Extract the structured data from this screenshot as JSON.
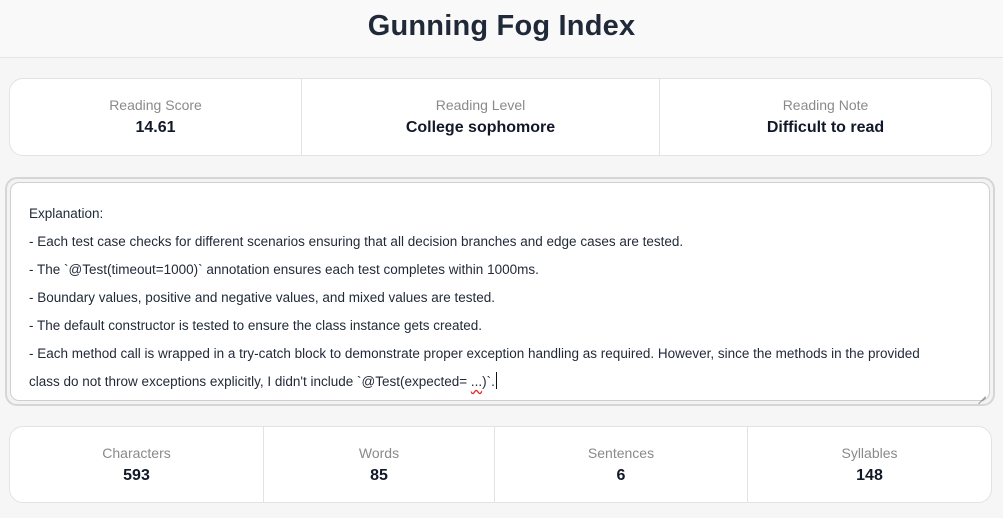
{
  "header": {
    "title": "Gunning Fog Index"
  },
  "reading": [
    {
      "label": "Reading Score",
      "value": "14.61"
    },
    {
      "label": "Reading Level",
      "value": "College sophomore"
    },
    {
      "label": "Reading Note",
      "value": "Difficult to read"
    }
  ],
  "editor": {
    "lines": [
      "Explanation:",
      "- Each test case checks for different scenarios ensuring that all decision branches and edge cases are tested.",
      "- The `@Test(timeout=1000)` annotation ensures each test completes within 1000ms.",
      "- Boundary values, positive and negative values, and mixed values are tested.",
      "- The default constructor is tested to ensure the class instance gets created.",
      "- Each method call is wrapped in a try-catch block to demonstrate proper exception handling as required. However, since the methods in the provided",
      "class do not throw exceptions explicitly, I didn't include `@Test(expected= "
    ],
    "squiggle_text": "...",
    "line_end": ")`."
  },
  "stats": [
    {
      "label": "Characters",
      "value": "593"
    },
    {
      "label": "Words",
      "value": "85"
    },
    {
      "label": "Sentences",
      "value": "6"
    },
    {
      "label": "Syllables",
      "value": "148"
    }
  ]
}
